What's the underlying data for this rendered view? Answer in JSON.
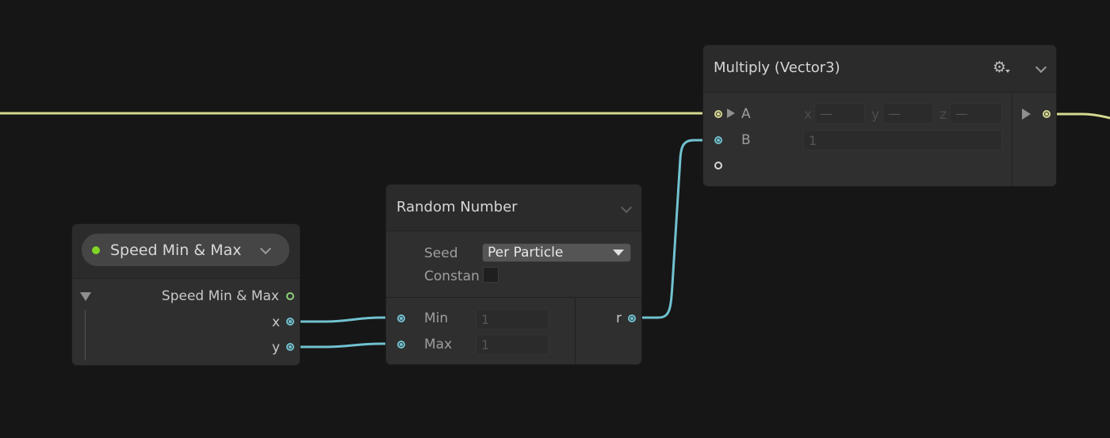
{
  "colors": {
    "background": "#161616",
    "node": "#2f2f2f",
    "vector_wire": "#d7d991",
    "float_wire": "#71c2d0",
    "property_dot": "#7fd624"
  },
  "property_node": {
    "pill_label": "Speed Min & Max",
    "output_label": "Speed Min & Max",
    "x_label": "x",
    "y_label": "y"
  },
  "random_node": {
    "title": "Random Number",
    "seed_label": "Seed",
    "seed_value": "Per Particle",
    "constant_label": "Constan",
    "min_label": "Min",
    "min_value": "1",
    "max_label": "Max",
    "max_value": "1",
    "output_label": "r"
  },
  "multiply_node": {
    "title": "Multiply (Vector3)",
    "a_label": "A",
    "a_x_label": "x",
    "a_x_value": "—",
    "a_y_label": "y",
    "a_y_value": "—",
    "a_z_label": "z",
    "a_z_value": "—",
    "b_label": "B",
    "b_value": "1"
  }
}
